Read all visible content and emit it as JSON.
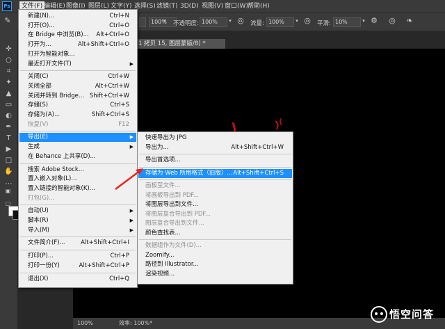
{
  "app": {
    "logo": "Ps"
  },
  "menubar": {
    "items": [
      "文件(F)",
      "编辑(E)",
      "图像(I)",
      "图层(L)",
      "文字(Y)",
      "选择(S)",
      "滤镜(T)",
      "3D(D)",
      "视图(V)",
      "窗口(W)",
      "帮助(H)"
    ],
    "active_index": 0
  },
  "options": {
    "opacity_label": "不透明度:",
    "opacity_value": "100%",
    "flow_label": "流量:",
    "flow_value": "100%",
    "smooth_label": "平滑:",
    "smooth_value": "10%",
    "left_value": "100%"
  },
  "document": {
    "tab_title": "1 拷贝 15, 图层蒙版/8) *",
    "zoom": "100%",
    "efficiency": "效率: 100%*"
  },
  "file_menu": {
    "items": [
      {
        "label": "新建(N)...",
        "shortcut": "Ctrl+N"
      },
      {
        "label": "打开(O)...",
        "shortcut": "Ctrl+O"
      },
      {
        "label": "在 Bridge 中浏览(B)...",
        "shortcut": "Alt+Ctrl+O"
      },
      {
        "label": "打开为...",
        "shortcut": "Alt+Shift+Ctrl+O"
      },
      {
        "label": "打开为智能对象...",
        "shortcut": ""
      },
      {
        "label": "最近打开文件(T)",
        "shortcut": "",
        "submenu": true
      },
      {
        "sep": true
      },
      {
        "label": "关闭(C)",
        "shortcut": "Ctrl+W"
      },
      {
        "label": "关闭全部",
        "shortcut": "Alt+Ctrl+W"
      },
      {
        "label": "关闭并转到 Bridge...",
        "shortcut": "Shift+Ctrl+W"
      },
      {
        "label": "存储(S)",
        "shortcut": "Ctrl+S"
      },
      {
        "label": "存储为(A)...",
        "shortcut": "Shift+Ctrl+S"
      },
      {
        "label": "恢复(V)",
        "shortcut": "F12",
        "disabled": true
      },
      {
        "sep": true
      },
      {
        "label": "导出(E)",
        "shortcut": "",
        "submenu": true,
        "highlight": true
      },
      {
        "label": "生成",
        "shortcut": "",
        "submenu": true
      },
      {
        "label": "在 Behance 上共享(D)...",
        "shortcut": ""
      },
      {
        "sep": true
      },
      {
        "label": "搜索 Adobe Stock...",
        "shortcut": ""
      },
      {
        "label": "置入嵌入对象(L)...",
        "shortcut": ""
      },
      {
        "label": "置入链接的智能对象(K)...",
        "shortcut": ""
      },
      {
        "label": "打包(G)...",
        "shortcut": "",
        "disabled": true
      },
      {
        "sep": true
      },
      {
        "label": "自动(U)",
        "shortcut": "",
        "submenu": true
      },
      {
        "label": "脚本(R)",
        "shortcut": "",
        "submenu": true
      },
      {
        "label": "导入(M)",
        "shortcut": "",
        "submenu": true
      },
      {
        "sep": true
      },
      {
        "label": "文件简介(F)...",
        "shortcut": "Alt+Shift+Ctrl+I"
      },
      {
        "sep": true
      },
      {
        "label": "打印(P)...",
        "shortcut": "Ctrl+P"
      },
      {
        "label": "打印一份(Y)",
        "shortcut": "Alt+Shift+Ctrl+P"
      },
      {
        "sep": true
      },
      {
        "label": "退出(X)",
        "shortcut": "Ctrl+Q"
      }
    ]
  },
  "export_menu": {
    "items": [
      {
        "label": "快速导出为 JPG",
        "shortcut": ""
      },
      {
        "label": "导出为...",
        "shortcut": "Alt+Shift+Ctrl+W"
      },
      {
        "sep": true
      },
      {
        "label": "导出首选项...",
        "shortcut": ""
      },
      {
        "sep": true
      },
      {
        "label": "存储为 Web 所用格式（旧版）...",
        "shortcut": "Alt+Shift+Ctrl+S",
        "highlight": true
      },
      {
        "sep": true
      },
      {
        "label": "画板至文件...",
        "shortcut": "",
        "disabled": true
      },
      {
        "label": "将画板导出到 PDF...",
        "shortcut": "",
        "disabled": true
      },
      {
        "label": "将图层导出到文件...",
        "shortcut": ""
      },
      {
        "label": "将图层复合导出到 PDF...",
        "shortcut": "",
        "disabled": true
      },
      {
        "label": "图层复合导出到文件...",
        "shortcut": "",
        "disabled": true
      },
      {
        "label": "颜色查找表...",
        "shortcut": ""
      },
      {
        "sep": true
      },
      {
        "label": "数据组作为文件(D)...",
        "shortcut": "",
        "disabled": true
      },
      {
        "label": "Zoomify...",
        "shortcut": ""
      },
      {
        "label": "路径到 Illustrator...",
        "shortcut": ""
      },
      {
        "label": "渲染视频...",
        "shortcut": ""
      }
    ]
  },
  "watermark": {
    "text": "悟空问答"
  },
  "colors": {
    "highlight": "#1e90ff",
    "arrow": "#e8231b"
  }
}
